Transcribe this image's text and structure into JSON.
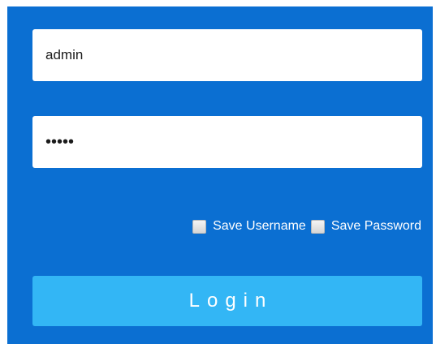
{
  "login_form": {
    "username": {
      "value": "admin"
    },
    "password": {
      "masked_value": "•••••"
    },
    "save_username_label": "Save Username",
    "save_password_label": "Save Password",
    "login_label": "Login"
  },
  "colors": {
    "panel_background": "#0b6fd2",
    "login_button": "#33b6f5"
  }
}
